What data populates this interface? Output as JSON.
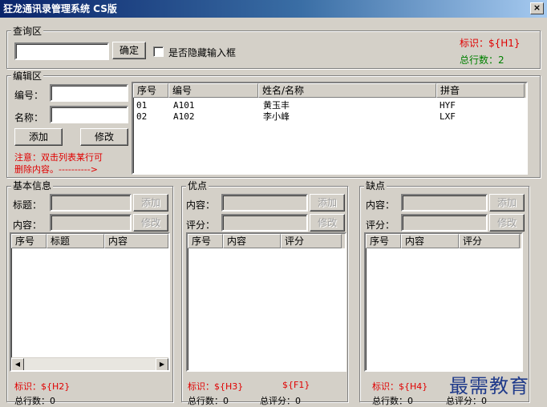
{
  "window": {
    "title": "狂龙通讯录管理系统 CS版",
    "close_glyph": "×"
  },
  "query_section": {
    "legend": "查询区",
    "input_value": "",
    "confirm_label": "确定",
    "hide_checkbox_label": "是否隐藏输入框",
    "hide_checked": false,
    "id_label": "标识：${H1}",
    "total_label": "总行数：2"
  },
  "edit_section": {
    "legend": "编辑区",
    "code_label": "编号：",
    "name_label": "名称：",
    "code_value": "",
    "name_value": "",
    "add_label": "添加",
    "modify_label": "修改",
    "note_line1": "注意：双击列表某行可",
    "note_line2": "删除内容。---------->",
    "list": {
      "columns": [
        "序号",
        "编号",
        "姓名/名称",
        "拼音"
      ],
      "rows": [
        [
          "01",
          "A101",
          "黄玉丰",
          "HYF"
        ],
        [
          "02",
          "A102",
          "李小峰",
          "LXF"
        ]
      ]
    }
  },
  "basic_section": {
    "legend": "基本信息",
    "title_label": "标题：",
    "content_label": "内容：",
    "add_label": "添加",
    "modify_label": "修改",
    "columns": [
      "序号",
      "标题",
      "内容"
    ],
    "id_label": "标识：${H2}",
    "total_label": "总行数：0"
  },
  "pros_section": {
    "legend": "优点",
    "content_label": "内容：",
    "score_label": "评分：",
    "add_label": "添加",
    "modify_label": "修改",
    "columns": [
      "序号",
      "内容",
      "评分"
    ],
    "id_label": "标识：${H3}",
    "f_label": "${F1}",
    "total_label": "总行数：0",
    "score_total_label": "总评分：0"
  },
  "cons_section": {
    "legend": "缺点",
    "content_label": "内容：",
    "score_label": "评分：",
    "add_label": "添加",
    "modify_label": "修改",
    "columns": [
      "序号",
      "内容",
      "评分"
    ],
    "id_label": "标识：${H4}",
    "total_label": "总行数：0",
    "score_total_label": "总评分：0"
  },
  "watermark": "最需教育",
  "colors": {
    "accent_red": "#e00000",
    "accent_green": "#008000",
    "window_bg": "#d4d0c8",
    "title_start": "#0a246a"
  }
}
